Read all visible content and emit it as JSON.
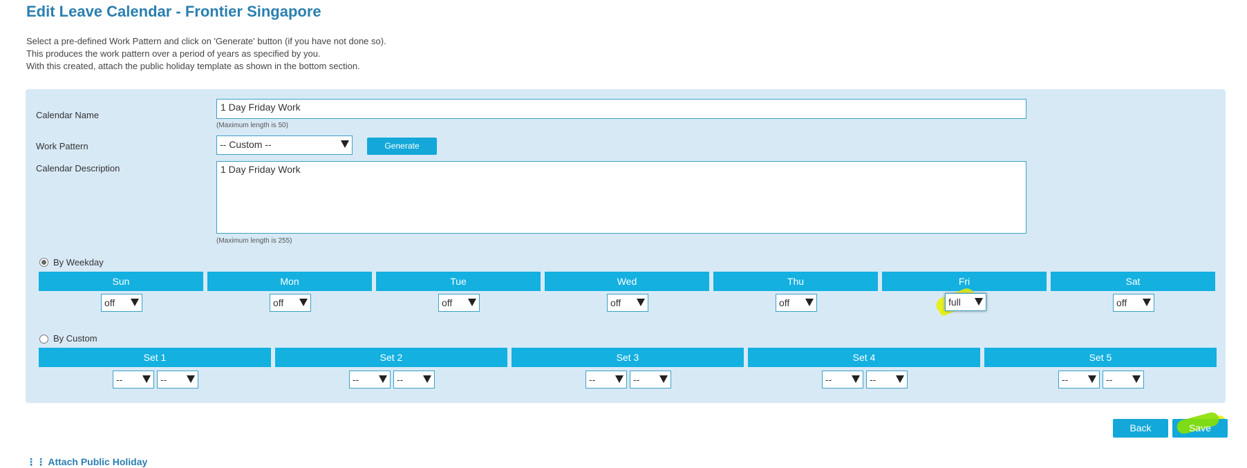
{
  "page": {
    "title": "Edit Leave Calendar - Frontier Singapore",
    "intro": [
      "Select a pre-defined Work Pattern and click on 'Generate' button (if you have not done so).",
      "This produces the work pattern over a period of years as specified by you.",
      "With this created, attach the public holiday template as shown in the bottom section."
    ]
  },
  "form": {
    "calendar_name_label": "Calendar Name",
    "calendar_name_value": "1 Day Friday Work",
    "calendar_name_hint": "(Maximum length is 50)",
    "work_pattern_label": "Work Pattern",
    "work_pattern_value": "-- Custom --",
    "generate_label": "Generate",
    "description_label": "Calendar Description",
    "description_value": "1 Day Friday Work",
    "description_hint": "(Maximum length is 255)"
  },
  "by_weekday": {
    "label": "By Weekday",
    "selected": true,
    "days": [
      {
        "name": "Sun",
        "value": "off"
      },
      {
        "name": "Mon",
        "value": "off"
      },
      {
        "name": "Tue",
        "value": "off"
      },
      {
        "name": "Wed",
        "value": "off"
      },
      {
        "name": "Thu",
        "value": "off"
      },
      {
        "name": "Fri",
        "value": "full"
      },
      {
        "name": "Sat",
        "value": "off"
      }
    ]
  },
  "by_custom": {
    "label": "By Custom",
    "selected": false,
    "sets": [
      {
        "name": "Set 1",
        "a": "--",
        "b": "--"
      },
      {
        "name": "Set 2",
        "a": "--",
        "b": "--"
      },
      {
        "name": "Set 3",
        "a": "--",
        "b": "--"
      },
      {
        "name": "Set 4",
        "a": "--",
        "b": "--"
      },
      {
        "name": "Set 5",
        "a": "--",
        "b": "--"
      }
    ]
  },
  "actions": {
    "back_label": "Back",
    "save_label": "Save"
  },
  "footer": {
    "attach_label": "Attach Public Holiday"
  },
  "colors": {
    "accent": "#13a8d9",
    "title": "#2a7fb0",
    "panel": "#d8e9f6",
    "highlight": "#e8f000"
  }
}
